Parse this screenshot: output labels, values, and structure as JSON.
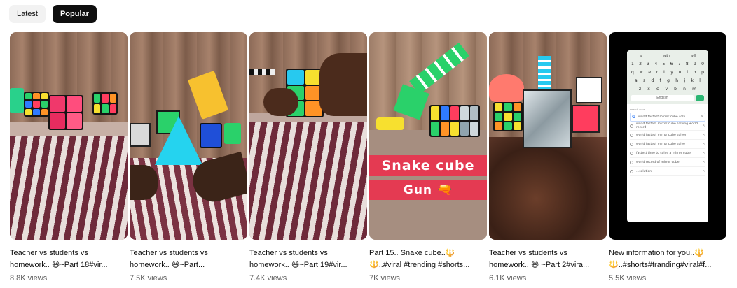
{
  "filters": {
    "latest": "Latest",
    "popular": "Popular",
    "selected": "Popular"
  },
  "videos": [
    {
      "title_line1": "Teacher vs students vs",
      "title_line2": "homework.. 😄~Part 18#vir...",
      "views": "8.8K views"
    },
    {
      "title_line1": "Teacher vs students vs",
      "title_line2": "homework.. 😄~Part...",
      "views": "7.5K views"
    },
    {
      "title_line1": "Teacher vs students vs",
      "title_line2": "homework.. 😄~Part 19#vir...",
      "views": "7.4K views"
    },
    {
      "title_line1": "Part 15.. Snake cube..🔱",
      "title_line2": "🔱..#viral #trending #shorts...",
      "views": "7K views",
      "overlay_line1": "Snake cube",
      "overlay_line2": "Gun 🔫"
    },
    {
      "title_line1": "Teacher vs students vs",
      "title_line2": "homework.. 😄 ~Part 2#vira...",
      "views": "6.1K views"
    },
    {
      "title_line1": "New information for you..🔱",
      "title_line2": "🔱..#shorts#tranding#viral#f...",
      "views": "5.5K views"
    }
  ],
  "phone_screen": {
    "keyboard_top": [
      "w",
      "with",
      "will"
    ],
    "keyboard_rows": [
      [
        "1",
        "2",
        "3",
        "4",
        "5",
        "6",
        "7",
        "8",
        "9",
        "0"
      ],
      [
        "q",
        "w",
        "e",
        "r",
        "t",
        "y",
        "u",
        "i",
        "o",
        "p"
      ],
      [
        "a",
        "s",
        "d",
        "f",
        "g",
        "h",
        "j",
        "k",
        "l"
      ],
      [
        "z",
        "x",
        "c",
        "v",
        "b",
        "n",
        "m"
      ]
    ],
    "search_text": "English",
    "suggestions_header": "search cube",
    "suggestions": [
      "world fastest mirror cube solv",
      "world fastest mirror cube solving world record",
      "world fastest mirror cube solver",
      "world fastest mirror cube solve",
      "fastest time to solve a mirror cube",
      "world record of mirror cube",
      "...solution"
    ]
  },
  "colors": {
    "chip_active_bg": "#0f0f0f",
    "chip_inactive_bg": "#f2f2f2",
    "meta_text": "#606060"
  }
}
